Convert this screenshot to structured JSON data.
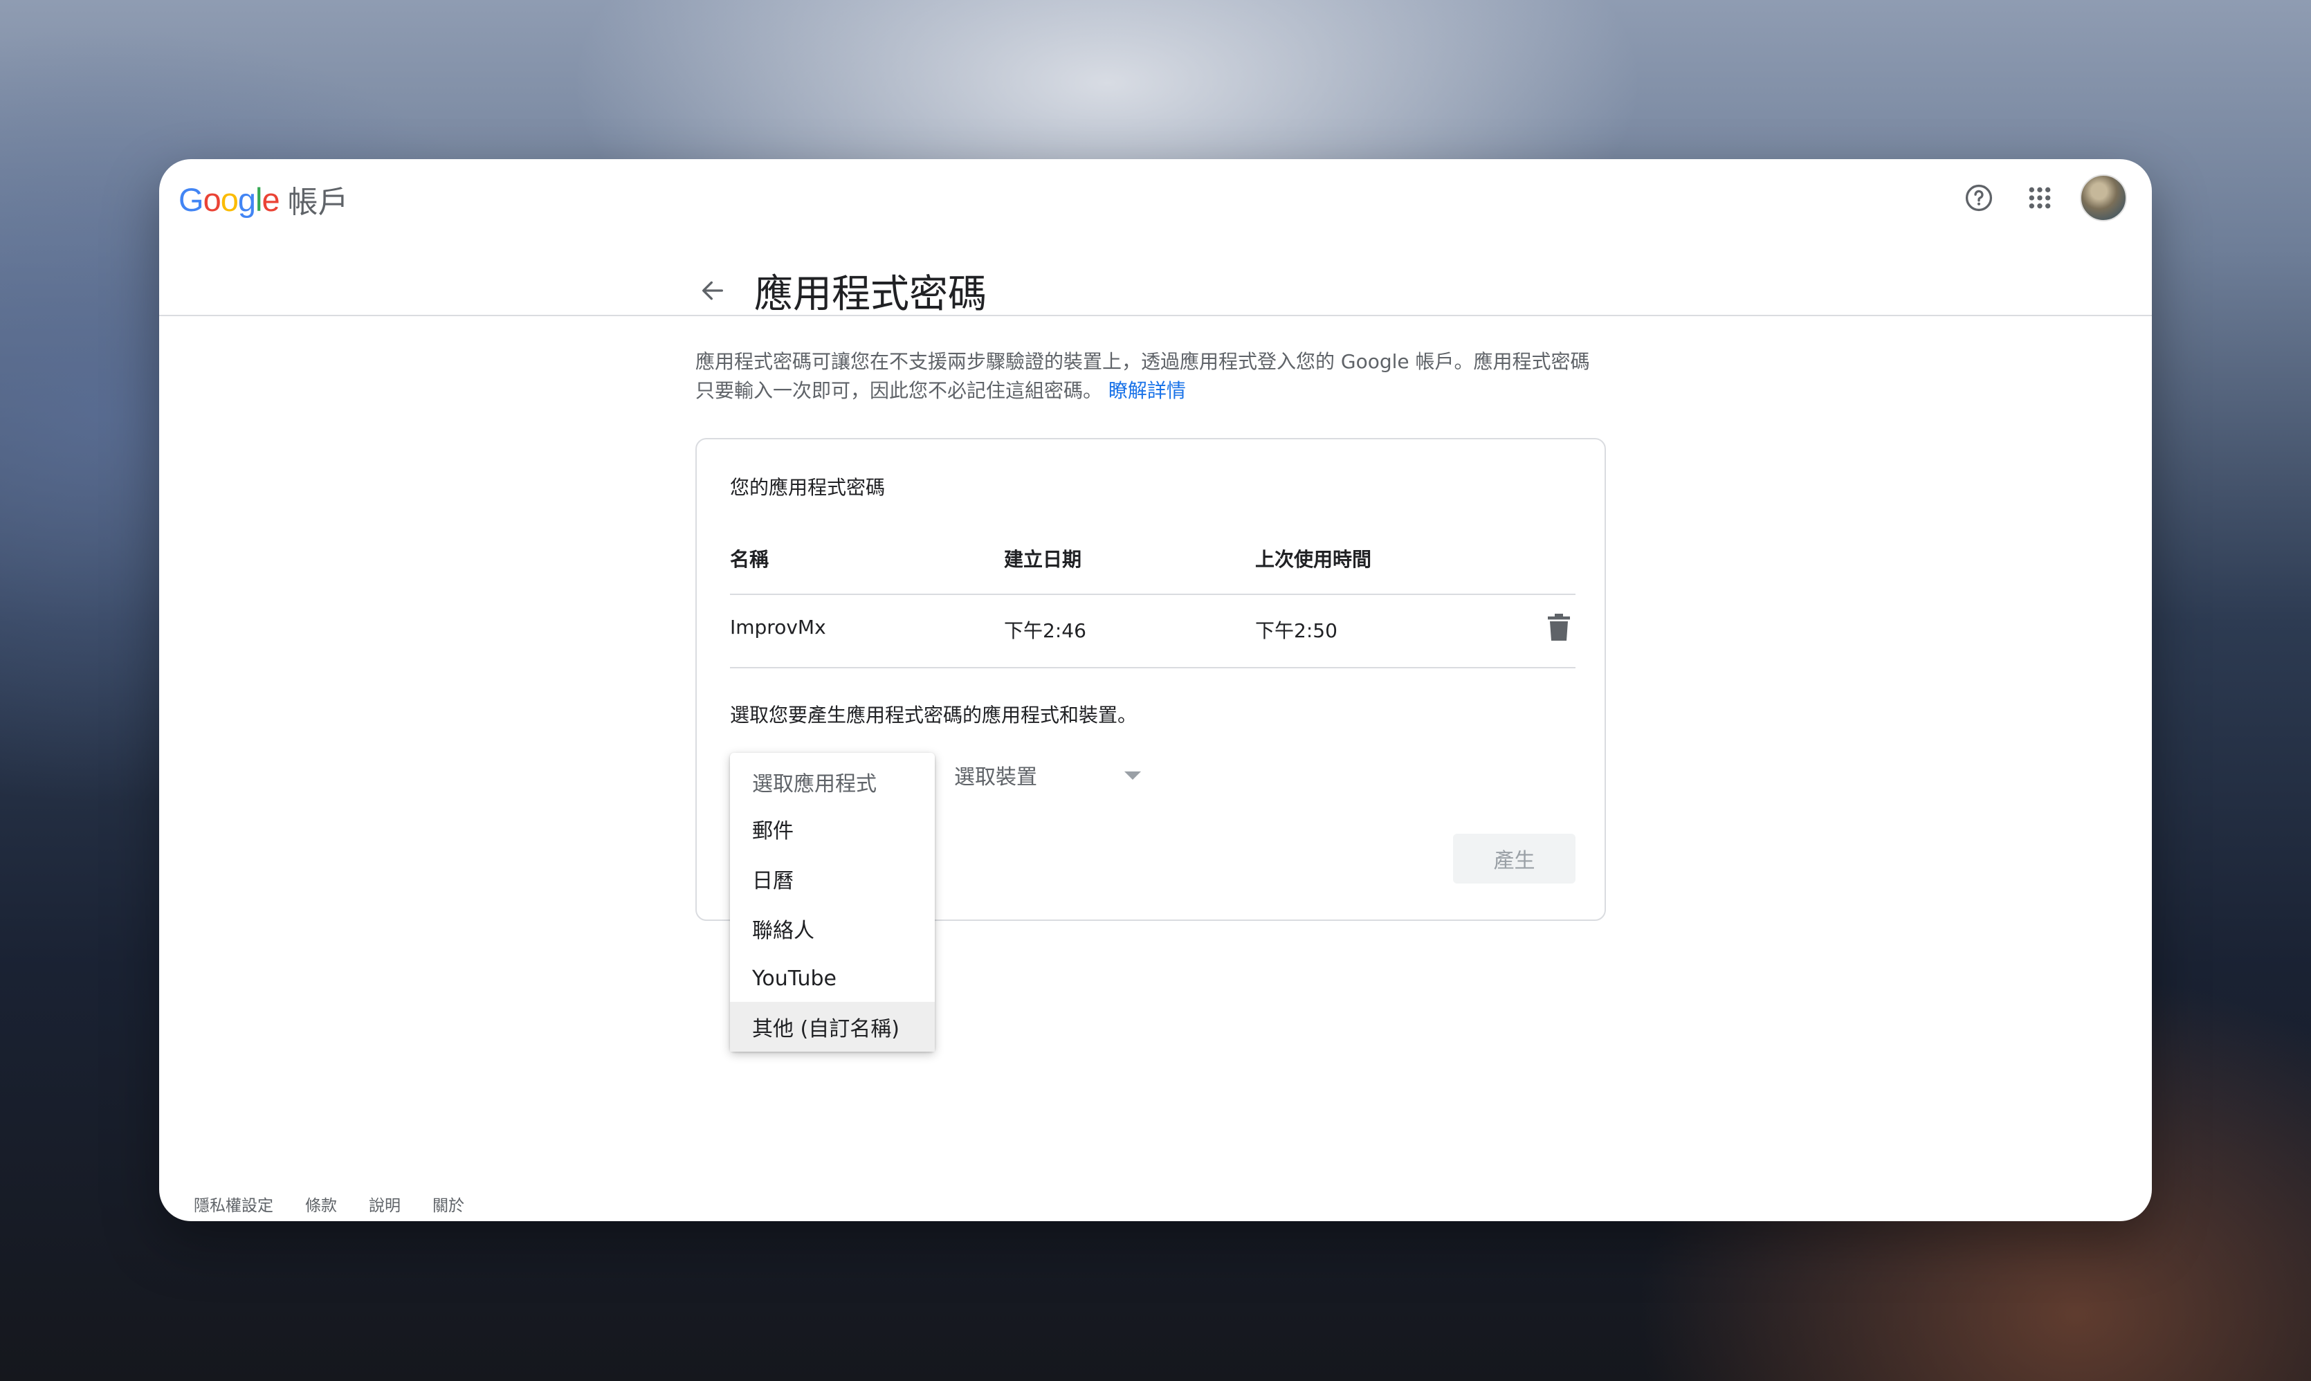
{
  "header": {
    "logo_letters": [
      {
        "ch": "G",
        "color": "#4285F4"
      },
      {
        "ch": "o",
        "color": "#EA4335"
      },
      {
        "ch": "o",
        "color": "#FBBC05"
      },
      {
        "ch": "g",
        "color": "#4285F4"
      },
      {
        "ch": "l",
        "color": "#34A853"
      },
      {
        "ch": "e",
        "color": "#EA4335"
      }
    ],
    "product_name": "帳戶",
    "icons": [
      "help-icon",
      "apps-grid-icon",
      "avatar"
    ]
  },
  "page": {
    "title": "應用程式密碼",
    "description": "應用程式密碼可讓您在不支援兩步驟驗證的裝置上，透過應用程式登入您的 Google 帳戶。應用程式密碼只要輸入一次即可，因此您不必記住這組密碼。",
    "learn_more": "瞭解詳情"
  },
  "card": {
    "title": "您的應用程式密碼",
    "columns": [
      "名稱",
      "建立日期",
      "上次使用時間"
    ],
    "rows": [
      {
        "name": "ImprovMx",
        "created": "下午2:46",
        "last_used": "下午2:50"
      }
    ],
    "select_prompt": "選取您要產生應用程式密碼的應用程式和裝置。",
    "device_placeholder": "選取裝置",
    "generate_label": "產生"
  },
  "app_dropdown": {
    "header": "選取應用程式",
    "options": [
      "郵件",
      "日曆",
      "聯絡人",
      "YouTube",
      "其他 (自訂名稱)"
    ],
    "highlighted": "其他 (自訂名稱)"
  },
  "footer": {
    "links": [
      "隱私權設定",
      "條款",
      "說明",
      "關於"
    ]
  },
  "colors": {
    "link": "#1a73e8",
    "text_primary": "#202124",
    "text_secondary": "#5f6368",
    "divider": "#dadce0"
  }
}
